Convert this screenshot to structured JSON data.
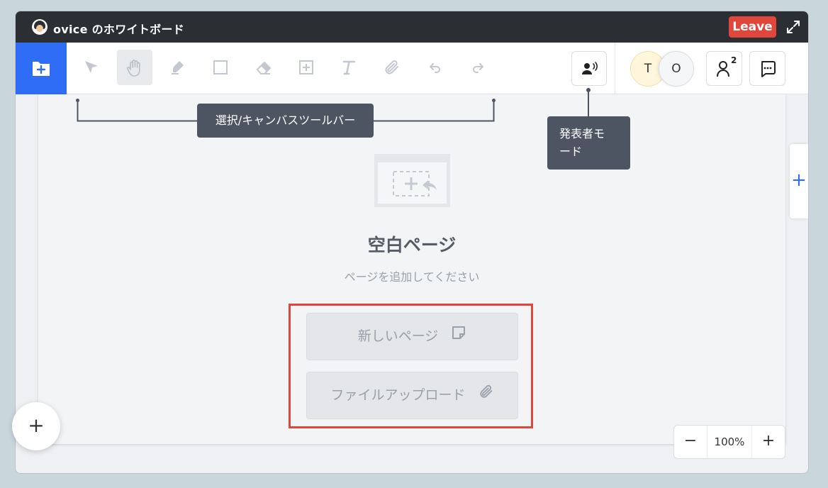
{
  "window": {
    "title": "ovice のホワイトボード",
    "leave_label": "Leave"
  },
  "toolbar": {
    "tools": [
      {
        "name": "select",
        "icon": "cursor-icon",
        "active": false
      },
      {
        "name": "hand",
        "icon": "hand-icon",
        "active": true
      },
      {
        "name": "pen",
        "icon": "marker-icon",
        "active": false
      },
      {
        "name": "rectangle",
        "icon": "square-icon",
        "active": false
      },
      {
        "name": "eraser",
        "icon": "eraser-icon",
        "active": false
      },
      {
        "name": "add-frame",
        "icon": "add-frame-icon",
        "active": false
      },
      {
        "name": "text",
        "icon": "text-icon",
        "active": false
      },
      {
        "name": "attach",
        "icon": "paperclip-icon",
        "active": false
      },
      {
        "name": "undo",
        "icon": "undo-icon",
        "active": false
      },
      {
        "name": "redo",
        "icon": "redo-icon",
        "active": false
      }
    ],
    "avatars": [
      {
        "initial": "T"
      },
      {
        "initial": "O"
      }
    ],
    "participant_count": "2"
  },
  "tooltips": {
    "toolbar_label": "選択/キャンバスツールバー",
    "presenter_line1": "発表者モ",
    "presenter_line2": "ード"
  },
  "empty_state": {
    "title": "空白ページ",
    "subtitle": "ページを追加してください",
    "new_page_label": "新しいページ",
    "upload_label": "ファイルアップロード"
  },
  "zoom": {
    "minus": "−",
    "value": "100%",
    "plus": "+"
  },
  "colors": {
    "accent": "#2f6df6",
    "leave": "#e0463b",
    "highlight": "#e0463b",
    "tooltip_bg": "#4d5562"
  }
}
